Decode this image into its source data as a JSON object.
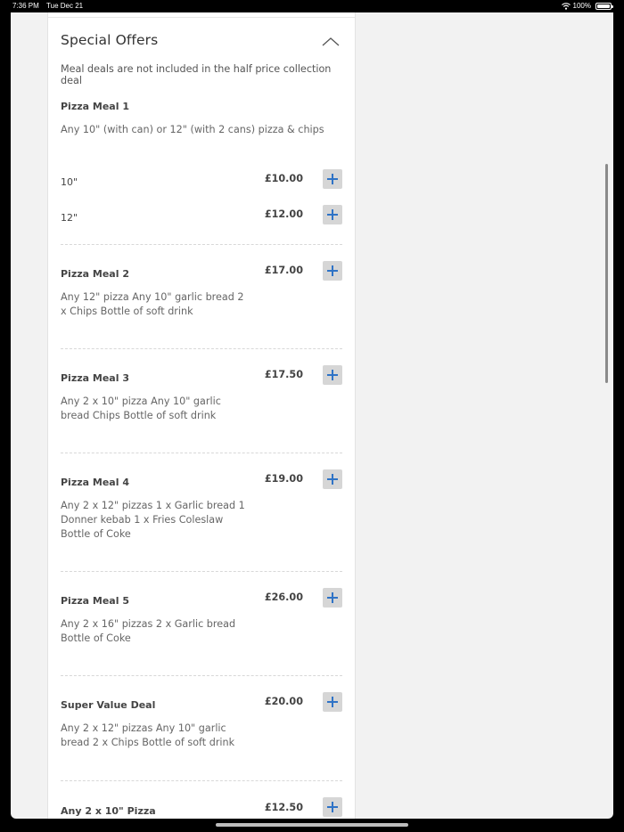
{
  "status_bar": {
    "time": "7:36 PM",
    "date": "Tue Dec 21",
    "battery": "100%"
  },
  "section": {
    "title": "Special Offers",
    "intro": "Meal deals are not included in the half price collection deal"
  },
  "meal1": {
    "name": "Pizza Meal 1",
    "description": "Any 10\" (with can) or 12\" (with 2 cans) pizza & chips",
    "options": [
      {
        "label": "10\"",
        "price": "£10.00"
      },
      {
        "label": "12\"",
        "price": "£12.00"
      }
    ]
  },
  "items": [
    {
      "name": "Pizza Meal 2",
      "price": "£17.00",
      "description": "Any 12\" pizza Any 10\" garlic bread 2 x Chips Bottle of soft drink"
    },
    {
      "name": "Pizza Meal 3",
      "price": "£17.50",
      "description": "Any 2 x 10\" pizza Any 10\" garlic bread Chips Bottle of soft drink"
    },
    {
      "name": "Pizza Meal 4",
      "price": "£19.00",
      "description": "Any 2 x 12\" pizzas 1 x Garlic bread 1 Donner kebab 1 x Fries Coleslaw Bottle of Coke"
    },
    {
      "name": "Pizza Meal 5",
      "price": "£26.00",
      "description": "Any 2 x 16\" pizzas 2 x Garlic bread Bottle of Coke"
    },
    {
      "name": "Super Value Deal",
      "price": "£20.00",
      "description": "Any 2 x 12\" pizzas Any 10\" garlic bread 2 x Chips Bottle of soft drink"
    },
    {
      "name": "Any 2 x 10\" Pizza",
      "price": "£12.50",
      "description": ""
    }
  ],
  "icons": {
    "collapse": "chevron-up-icon",
    "add": "plus-icon",
    "wifi": "wifi-icon",
    "battery": "battery-icon"
  },
  "colors": {
    "accent": "#2f73c6",
    "button_bg": "#d6d6d6"
  }
}
